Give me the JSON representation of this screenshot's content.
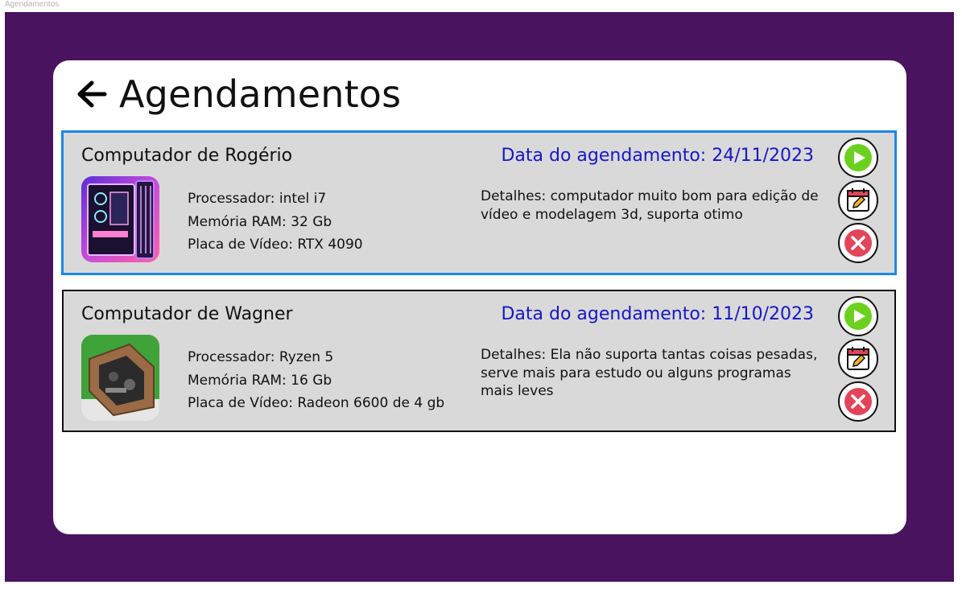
{
  "window": {
    "title": "Agendamentos"
  },
  "page": {
    "title": "Agendamentos"
  },
  "colors": {
    "frame_bg": "#4a135f",
    "card_bg": "#d9d9d9",
    "date_text": "#1717c4",
    "selected_border": "#1e88e5",
    "start_green": "#6bd11e",
    "cancel_red": "#e2455a"
  },
  "icons": {
    "back": "arrow-left-icon",
    "start": "play-icon",
    "reschedule": "calendar-edit-icon",
    "cancel": "close-icon"
  },
  "appointments": [
    {
      "name": "Computador de Rogério",
      "date": "Data do agendamento: 24/11/2023",
      "processor": "Processador: intel i7",
      "ram": "Memória RAM: 32 Gb",
      "gpu": "Placa de Vídeo: RTX 4090",
      "details": "Detalhes: computador muito bom para edição de vídeo e modelagem 3d, suporta otimo",
      "selected": true
    },
    {
      "name": "Computador de Wagner",
      "date": "Data do agendamento: 11/10/2023",
      "processor": "Processador: Ryzen 5",
      "ram": "Memória RAM: 16 Gb",
      "gpu": "Placa de Vídeo: Radeon 6600  de 4 gb",
      "details": "Detalhes: Ela não suporta tantas coisas pesadas, serve mais para estudo ou alguns programas mais leves",
      "selected": false
    }
  ]
}
